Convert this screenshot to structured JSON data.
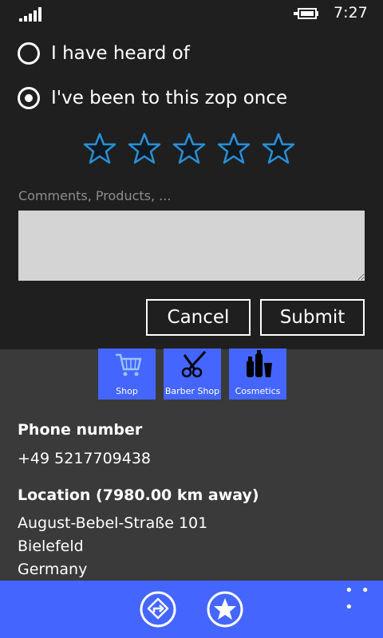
{
  "status": {
    "time": "7:27"
  },
  "dialog": {
    "options": [
      {
        "label": "I have heard of",
        "checked": false
      },
      {
        "label": "I've been to this zop once",
        "checked": true
      }
    ],
    "rating": {
      "max": 5,
      "value": 0
    },
    "comment_placeholder": "Comments, Products, ...",
    "comment_value": "",
    "cancel_label": "Cancel",
    "submit_label": "Submit"
  },
  "categories": [
    {
      "label": "Shop",
      "icon": "shopping-cart-icon"
    },
    {
      "label": "Barber Shop",
      "icon": "scissors-icon"
    },
    {
      "label": "Cosmetics",
      "icon": "cosmetics-bottles-icon"
    }
  ],
  "details": {
    "phone_title": "Phone number",
    "phone": "+49 5217709438",
    "location_title": "Location (7980.00 km away)",
    "address": [
      "August-Bebel-Straße  101",
      "Bielefeld",
      "Germany"
    ]
  },
  "app_bar": {
    "more_label": "• • •",
    "icons": [
      "directions-icon",
      "favorite-star-icon"
    ]
  },
  "colors": {
    "accent": "#4466ff",
    "dialog_bg": "#1f1f1f",
    "page_bg": "#3a3a3a",
    "star_stroke": "#2a8fd6"
  }
}
